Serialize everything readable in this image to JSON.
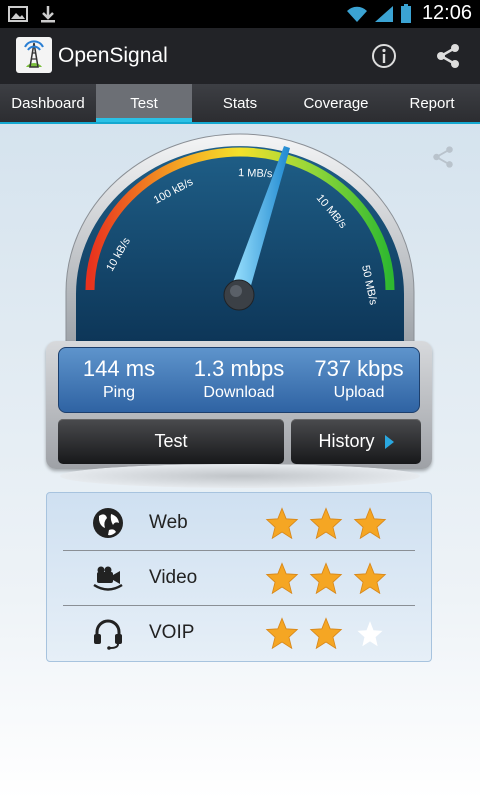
{
  "status_bar": {
    "time": "12:06"
  },
  "app": {
    "title": "OpenSignal"
  },
  "tabs": [
    {
      "label": "Dashboard",
      "active": false
    },
    {
      "label": "Test",
      "active": true
    },
    {
      "label": "Stats",
      "active": false
    },
    {
      "label": "Coverage",
      "active": false
    },
    {
      "label": "Report",
      "active": false
    }
  ],
  "gauge": {
    "scale_labels": [
      "10 kB/s",
      "100 kB/s",
      "1 MB/s",
      "10 MB/s",
      "50 MB/s"
    ]
  },
  "results": {
    "ping": {
      "value": "144 ms",
      "label": "Ping"
    },
    "download": {
      "value": "1.3 mbps",
      "label": "Download"
    },
    "upload": {
      "value": "737 kbps",
      "label": "Upload"
    }
  },
  "buttons": {
    "test": "Test",
    "history": "History"
  },
  "ratings": [
    {
      "label": "Web",
      "icon": "globe-icon",
      "stars": 3,
      "max": 3
    },
    {
      "label": "Video",
      "icon": "video-camera-icon",
      "stars": 3,
      "max": 3
    },
    {
      "label": "VOIP",
      "icon": "headset-icon",
      "stars": 2,
      "max": 3
    }
  ],
  "colors": {
    "accent": "#2ac1e6",
    "star": "#f5a623",
    "readout": "#2f63a3"
  }
}
